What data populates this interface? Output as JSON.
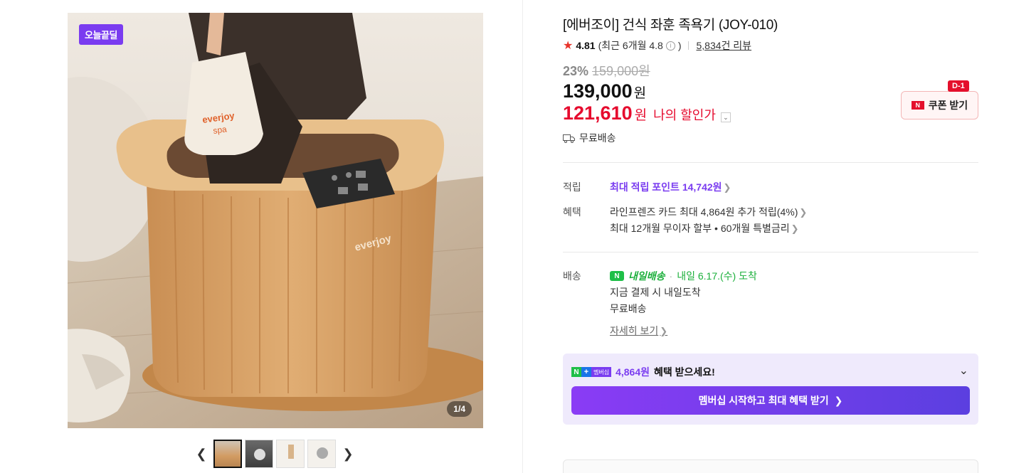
{
  "gallery": {
    "badge": "오늘끝딜",
    "page_current": "1",
    "page_total": "/4",
    "prev_icon": "chevron-left-icon",
    "next_icon": "chevron-right-icon"
  },
  "product": {
    "title": "[에버조이] 건식 좌훈 족욕기 (JOY-010)",
    "rating": "4.81",
    "recent_rating_prefix": "(최근 6개월 4.8",
    "recent_rating_suffix": ")",
    "review_count": "5,834건 리뷰"
  },
  "price": {
    "discount_pct": "23%",
    "original_price": "159,000원",
    "sale_price": "139,000",
    "won": "원",
    "my_price": "121,610",
    "my_price_label": "나의 할인가"
  },
  "coupon": {
    "label": "쿠폰 받기",
    "badge": "D-1",
    "brand_letter": "N"
  },
  "shipping_top": "무료배송",
  "points": {
    "label": "적립",
    "text": "최대 적립 포인트",
    "amount": "14,742원"
  },
  "benefits": {
    "label": "혜택",
    "line1": "라인프렌즈 카드 최대 4,864원 추가 적립(4%)",
    "line2": "최대 12개월 무이자 할부 • 60개월 특별금리"
  },
  "delivery": {
    "label": "배송",
    "brand": "내일배송",
    "date_text": "내일 6.17.(수) 도착",
    "line2": "지금 결제 시 내일도착",
    "line3": "무료배송",
    "detail_link": "자세히 보기"
  },
  "membership": {
    "logo_text": "멤버십",
    "amount": "4,864원",
    "text": "혜택 받으세요!",
    "button": "멤버십 시작하고 최대 혜택 받기"
  },
  "colors": {
    "accent_red": "#e60b2e",
    "purple": "#7a3cf0",
    "green": "#1fbf48"
  }
}
